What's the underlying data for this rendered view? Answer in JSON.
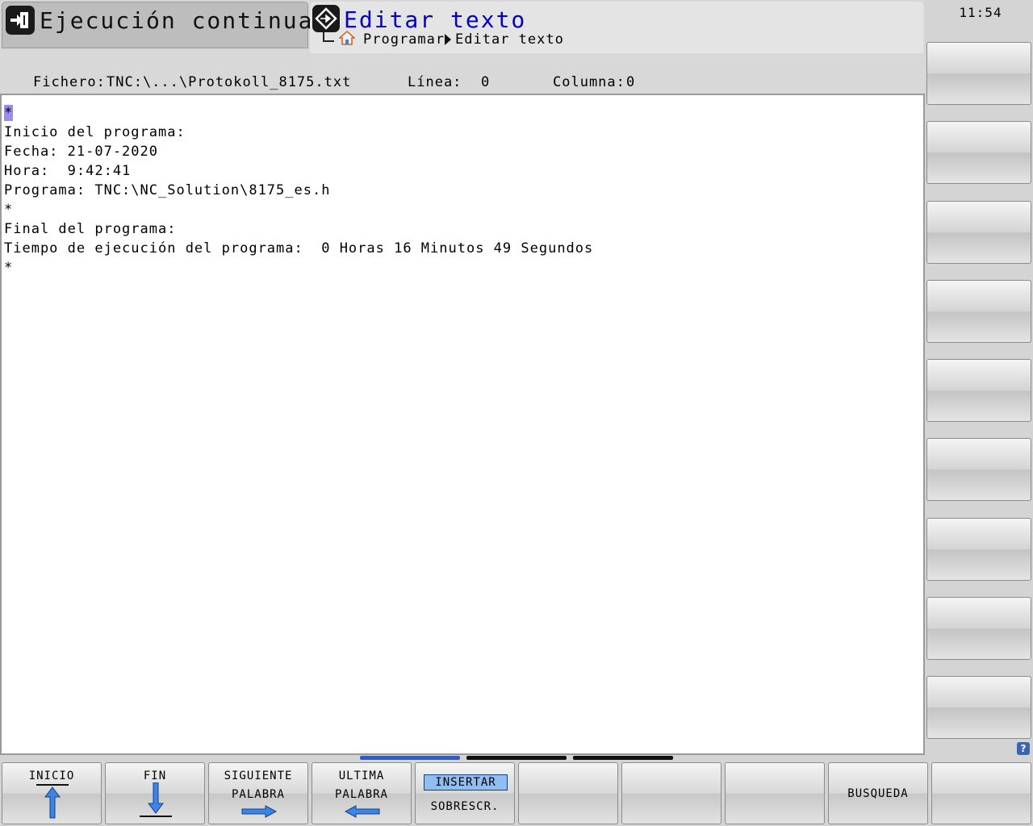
{
  "header": {
    "machine_mode_label": "Ejecución continua",
    "program_mode_label": "Editar texto",
    "breadcrumb": [
      "Programar",
      "Editar texto"
    ]
  },
  "fileinfo": {
    "file_label": "Fichero:",
    "file_value": "TNC:\\...\\Protokoll_8175.txt",
    "line_label": "Línea:",
    "line_value": "0",
    "column_label": "Columna:",
    "column_value": "0"
  },
  "editor": {
    "lines": [
      "*",
      "Inicio del programa:",
      "Fecha: 21-07-2020",
      "Hora:  9:42:41",
      "Programa: TNC:\\NC_Solution\\8175_es.h",
      "*",
      "Final del programa:",
      "Tiempo de ejecución del programa:  0 Horas 16 Minutos 49 Segundos",
      "*"
    ]
  },
  "clock": "11:54",
  "softkeys": {
    "inicio": "INICIO",
    "fin": "FIN",
    "siguiente_1": "SIGUIENTE",
    "siguiente_2": "PALABRA",
    "ultima_1": "ULTIMA",
    "ultima_2": "PALABRA",
    "insertar": "INSERTAR",
    "sobrescr": "SOBRESCR.",
    "busqueda": "BUSQUEDA"
  },
  "help_icon": "?",
  "colors": {
    "accent_blue": "#0000c8",
    "cursor": "#9b8cf0",
    "insert_active": "#8fbff0",
    "page_active": "#2a5cd8"
  }
}
